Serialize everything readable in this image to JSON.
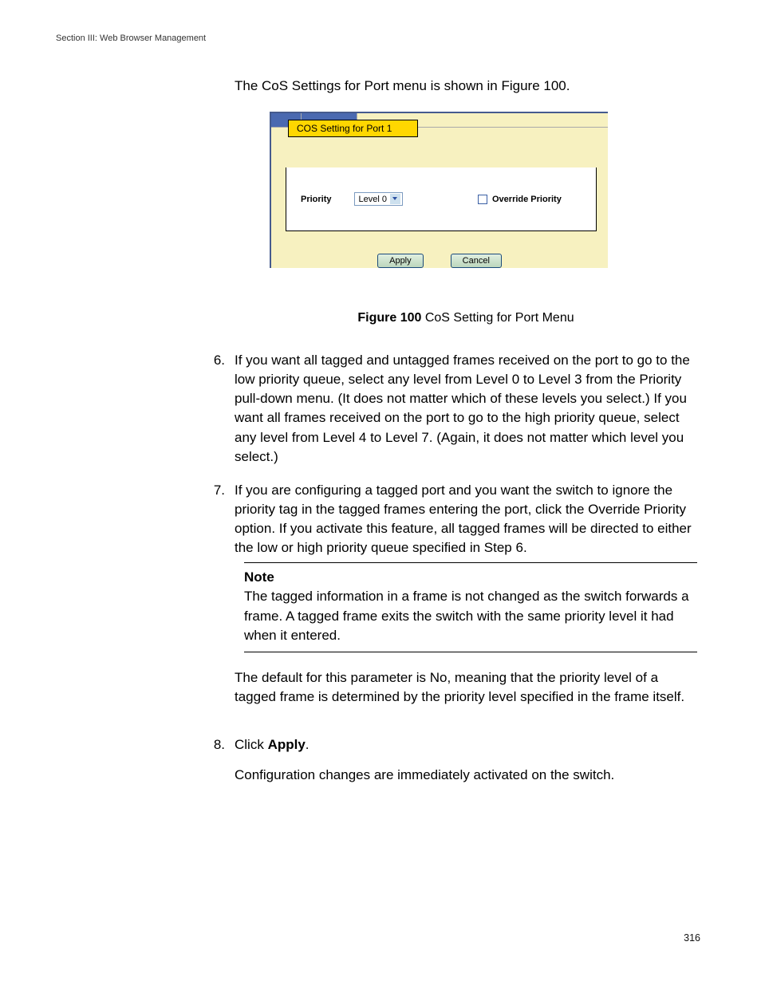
{
  "header": {
    "section": "Section III: Web Browser Management"
  },
  "intro": "The CoS Settings for Port menu is shown in Figure 100.",
  "figure": {
    "title": "COS Setting for Port 1",
    "priority_label": "Priority",
    "priority_value": "Level 0",
    "override_label": "Override Priority",
    "apply_label": "Apply",
    "cancel_label": "Cancel",
    "caption_bold": "Figure 100",
    "caption_rest": "  CoS Setting for Port Menu"
  },
  "items": {
    "6": {
      "num": "6.",
      "text": "If you want all tagged and untagged frames received on the port to go to the low priority queue, select any level from Level 0 to Level 3 from the Priority pull-down menu. (It does not matter which of these levels you select.) If you want all frames received on the port to go to the high priority queue, select any level from Level 4 to Level 7. (Again, it does not matter which level you select.)"
    },
    "7": {
      "num": "7.",
      "text": "If you are configuring a tagged port and you want the switch to ignore the priority tag in the tagged frames entering the port, click the Override Priority option. If you activate this feature, all tagged frames will be directed to either the low or high priority queue specified in Step 6."
    },
    "8": {
      "num": "8.",
      "pre": "Click ",
      "bold": "Apply",
      "post": "."
    }
  },
  "note": {
    "head": "Note",
    "body": "The tagged information in a frame is not changed as the switch forwards a frame. A tagged frame exits the switch with the same priority level it had when it entered."
  },
  "after_note": "The default for this parameter is No, meaning that the priority level of a tagged frame is determined by the priority level specified in the frame itself.",
  "post_step8": "Configuration changes are immediately activated on the switch.",
  "page_number": "316"
}
